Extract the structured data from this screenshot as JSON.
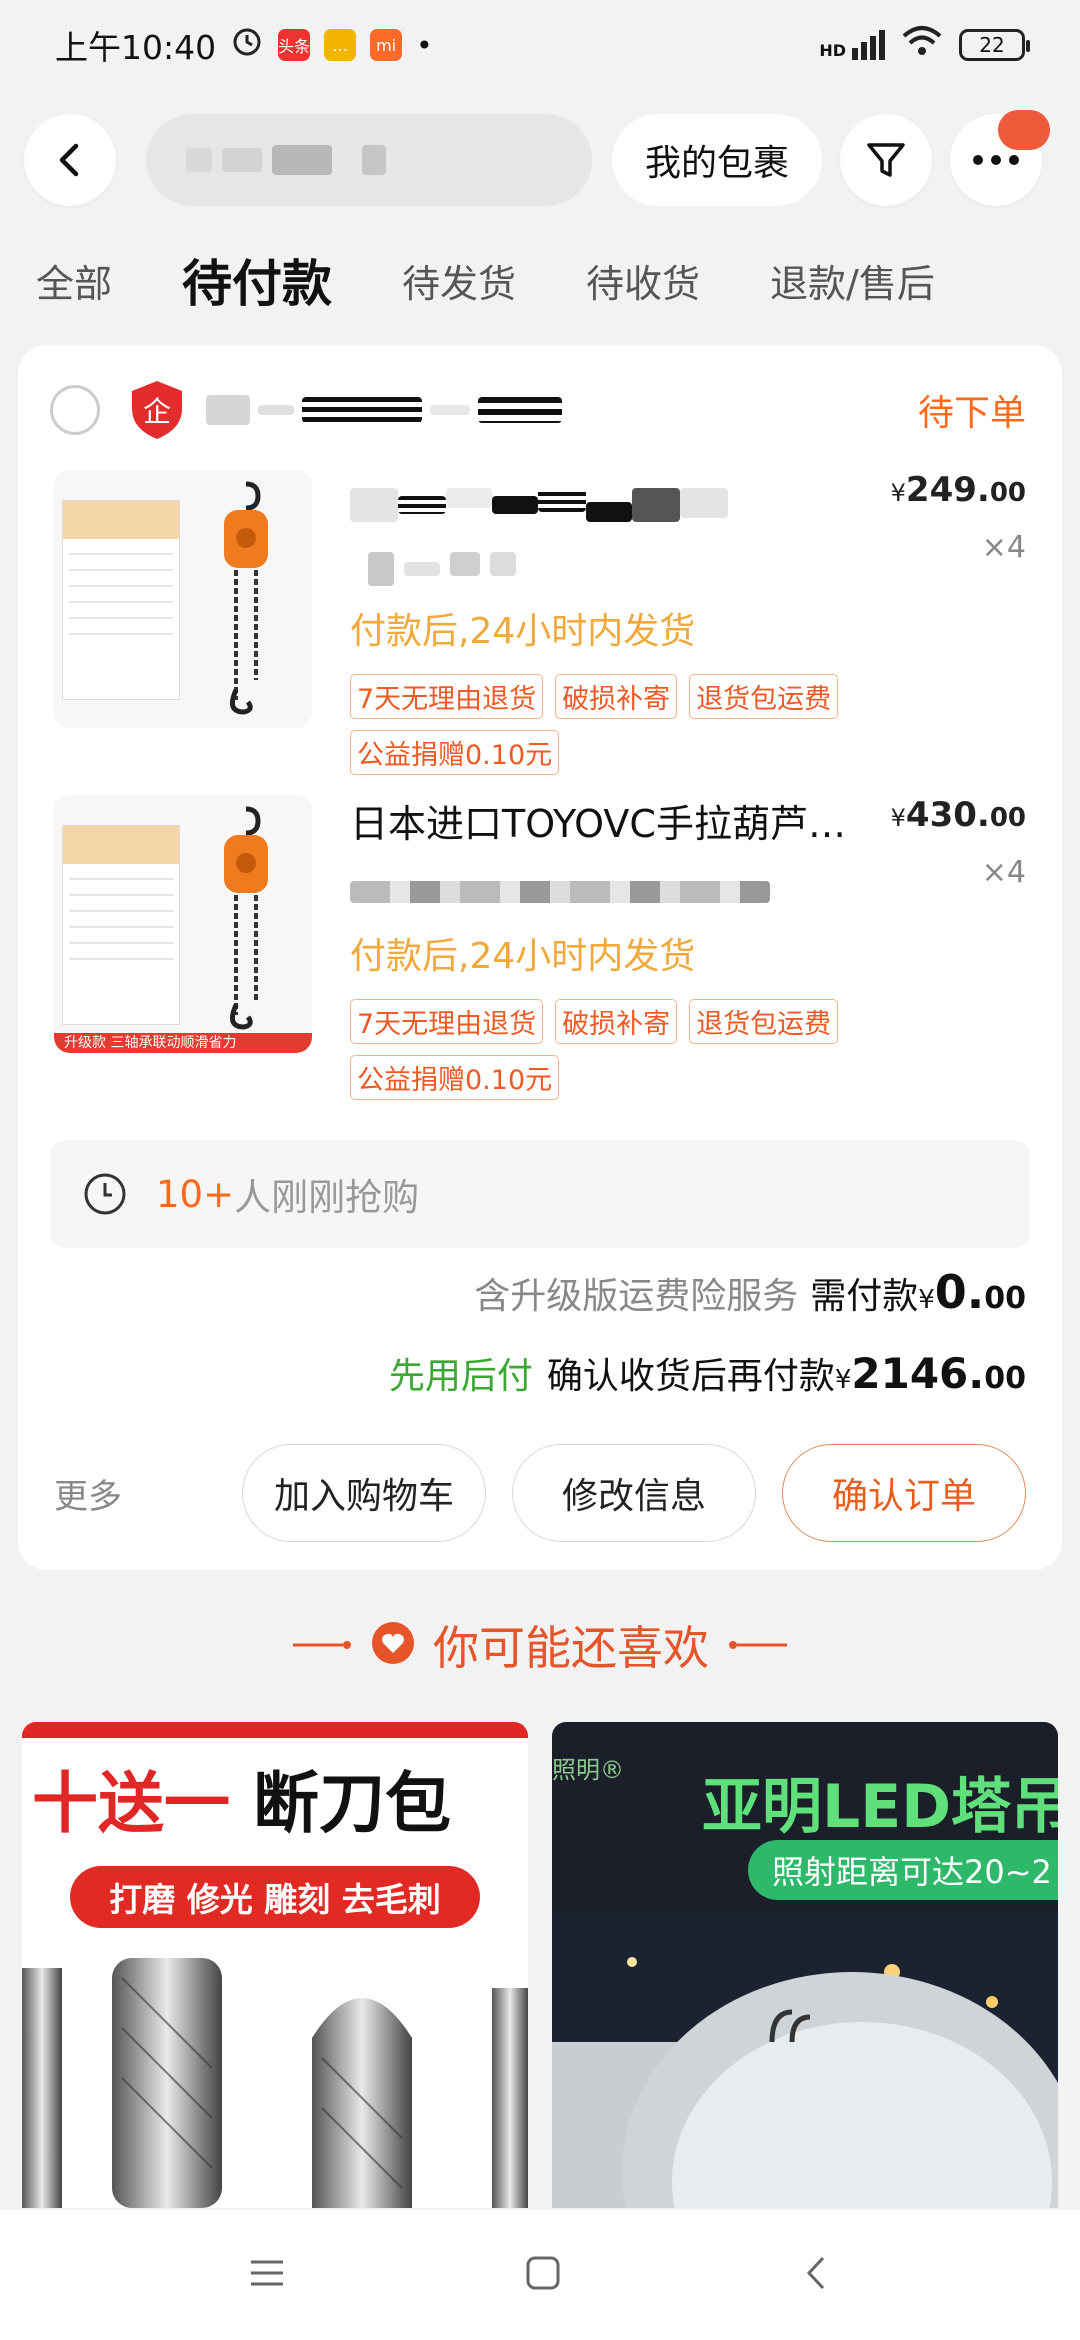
{
  "status_bar": {
    "time": "上午10:40",
    "badge_toutiao": "头条",
    "badge_mi": "mi",
    "network": "HD",
    "battery": "22"
  },
  "top_nav": {
    "package_label": "我的包裹"
  },
  "tabs": [
    {
      "label": "全部"
    },
    {
      "label": "待付款"
    },
    {
      "label": "待发货"
    },
    {
      "label": "待收货"
    },
    {
      "label": "退款/售后"
    }
  ],
  "order": {
    "status": "待下单",
    "items": [
      {
        "title": "",
        "price_currency": "¥",
        "price_int": "249.",
        "price_dec": "00",
        "qty": "×4",
        "ship_note": "付款后,24小时内发货",
        "tags": [
          "7天无理由退货",
          "破损补寄",
          "退货包运费"
        ],
        "tag_extra": "公益捐赠0.10元",
        "thumb_upgrade": ""
      },
      {
        "title": "日本进口TOYOVC手拉葫芦…",
        "price_currency": "¥",
        "price_int": "430.",
        "price_dec": "00",
        "qty": "×4",
        "ship_note": "付款后,24小时内发货",
        "tags": [
          "7天无理由退货",
          "破损补寄",
          "退货包运费"
        ],
        "tag_extra": "公益捐赠0.10元",
        "thumb_upgrade": "升级款 三轴承联动顺滑省力"
      }
    ],
    "buyers_count": "10+",
    "buyers_text": "人刚刚抢购",
    "insurance_text": "含升级版运费险服务",
    "pay_label": "需付款",
    "pay_currency": "¥",
    "pay_int": "0.",
    "pay_dec": "00",
    "later_pay_label": "先用后付",
    "later_pay_text": "确认收货后再付款",
    "later_currency": "¥",
    "later_int": "2146.",
    "later_dec": "00",
    "more_label": "更多",
    "btn_cart": "加入购物车",
    "btn_edit": "修改信息",
    "btn_confirm": "确认订单"
  },
  "recommend": {
    "title": "你可能还喜欢",
    "left": {
      "headline_red": "十送一",
      "headline_black": " 断刀包",
      "pill": "打磨 修光 雕刻 去毛刺"
    },
    "right": {
      "brand": "照明®",
      "headline": "亚明LED塔吊",
      "pill": "照射距离可达20~2"
    }
  },
  "colors": {
    "accent_orange": "#ff6a1a",
    "ship_yellow": "#f2a93b",
    "green": "#3aa832",
    "tag_red": "#ee5a24"
  }
}
